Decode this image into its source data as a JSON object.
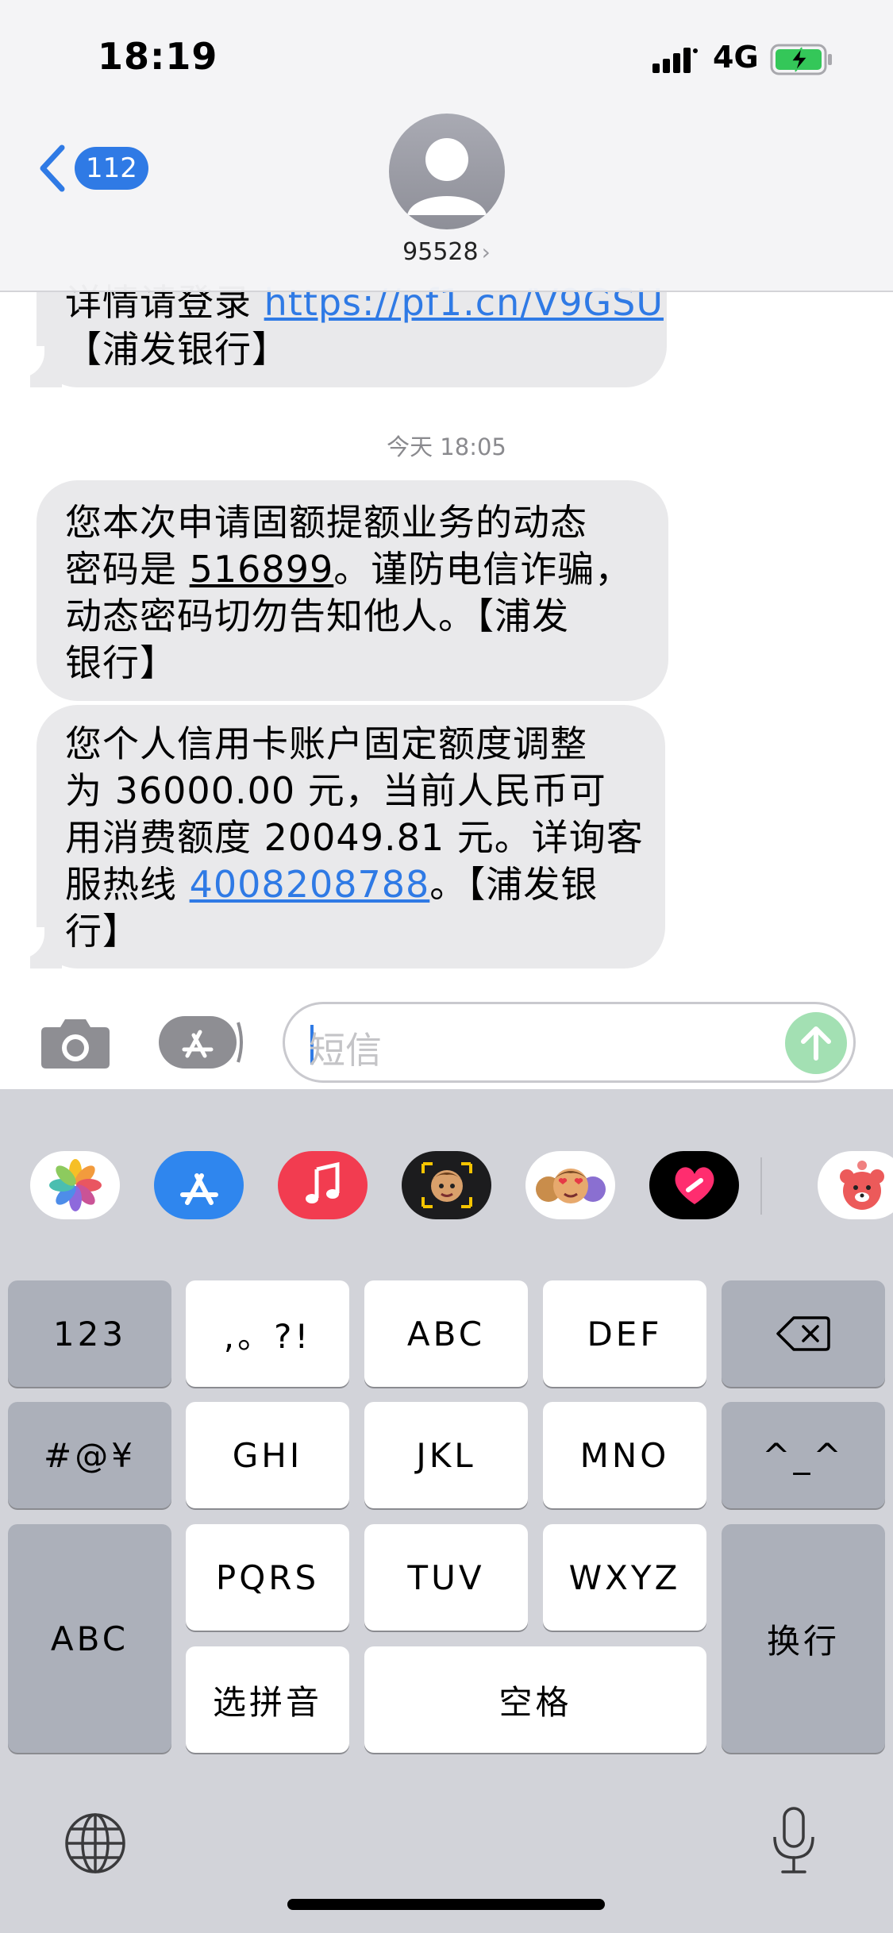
{
  "status_bar": {
    "time": "18:19",
    "network": "4G"
  },
  "header": {
    "back_count": "112",
    "contact": "95528",
    "contact_chevron": "›"
  },
  "messages": [
    {
      "lines": [
        "详情请登录 ",
        "https://pf1.cn/V9GSU",
        "【浦发银行】"
      ]
    },
    {
      "lines": [
        "您本次申请固额提额业务的动态",
        "密码是 ",
        "516899",
        "。谨防电信诈骗，",
        "动态密码切勿告知他人。【浦发",
        "银行】"
      ]
    },
    {
      "lines": [
        "您个人信用卡账户固定额度调整",
        "为 36000.00 元，当前人民币可",
        "用消费额度 20049.81 元。详询客",
        "服热线 ",
        "4008208788",
        "。【浦发银",
        "行】"
      ]
    }
  ],
  "timestamp": "今天 18:05",
  "input": {
    "placeholder": "短信"
  },
  "app_drawer": [
    "photos",
    "app-store",
    "music",
    "memoji",
    "animoji-stickers",
    "digital-touch",
    "bear-sticker-app"
  ],
  "keyboard": {
    "rows": {
      "r1": [
        "123",
        ",。?!",
        "ABC",
        "DEF"
      ],
      "r2": [
        "#@¥",
        "GHI",
        "JKL",
        "MNO",
        "^_^"
      ],
      "r3": [
        "PQRS",
        "TUV",
        "WXYZ"
      ],
      "r4": [
        "选拼音",
        "空格"
      ],
      "left_abc": "ABC",
      "return": "换行"
    }
  },
  "colors": {
    "link": "#2f7ae5",
    "bubble": "#e9e9eb",
    "keyboard_bg": "#d2d3d9",
    "send": "#a3e0b3"
  }
}
